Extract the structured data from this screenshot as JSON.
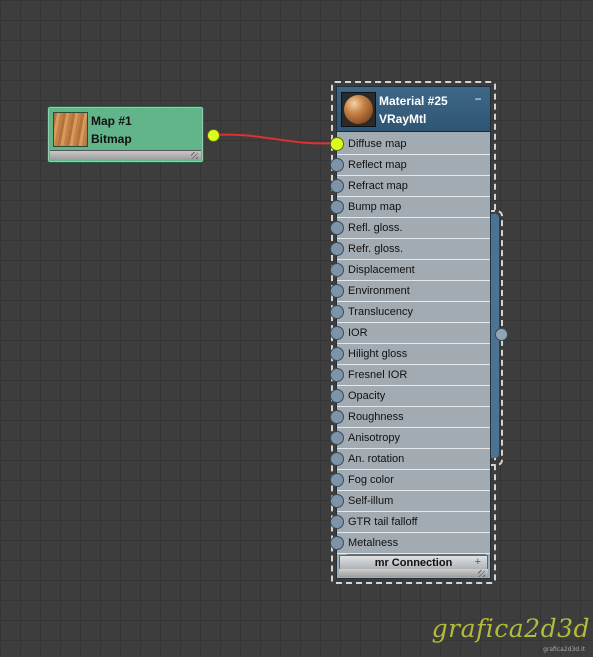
{
  "map_node": {
    "title": "Map #1",
    "subtitle": "Bitmap",
    "thumbnail": "wood-texture",
    "color": "#62b48a"
  },
  "material_node": {
    "title": "Material #25",
    "subtitle": "VRayMtl",
    "collapse_label": "−",
    "header_color": "#3e6787",
    "slots": [
      {
        "label": "Diffuse map",
        "connected": true
      },
      {
        "label": "Reflect map",
        "connected": false
      },
      {
        "label": "Refract map",
        "connected": false
      },
      {
        "label": "Bump map",
        "connected": false
      },
      {
        "label": "Refl. gloss.",
        "connected": false
      },
      {
        "label": "Refr. gloss.",
        "connected": false
      },
      {
        "label": "Displacement",
        "connected": false
      },
      {
        "label": "Environment",
        "connected": false
      },
      {
        "label": "Translucency",
        "connected": false
      },
      {
        "label": "IOR",
        "connected": false
      },
      {
        "label": "Hilight gloss",
        "connected": false
      },
      {
        "label": "Fresnel IOR",
        "connected": false
      },
      {
        "label": "Opacity",
        "connected": false
      },
      {
        "label": "Roughness",
        "connected": false
      },
      {
        "label": "Anisotropy",
        "connected": false
      },
      {
        "label": "An. rotation",
        "connected": false
      },
      {
        "label": "Fog color",
        "connected": false
      },
      {
        "label": "Self-illum",
        "connected": false
      },
      {
        "label": "GTR tail falloff",
        "connected": false
      },
      {
        "label": "Metalness",
        "connected": false
      }
    ],
    "mr_connection_label": "mr Connection",
    "mr_expand_label": "+"
  },
  "wire": {
    "color": "#e03030",
    "from": "Map #1",
    "to": "Diffuse map"
  },
  "watermark": {
    "text": "grafica2d3d",
    "sub": "grafica2d3d.it"
  },
  "colors": {
    "socket_connected": "#d8ff1f",
    "socket_idle": "#7d93a8",
    "background": "#3d3d3d"
  }
}
